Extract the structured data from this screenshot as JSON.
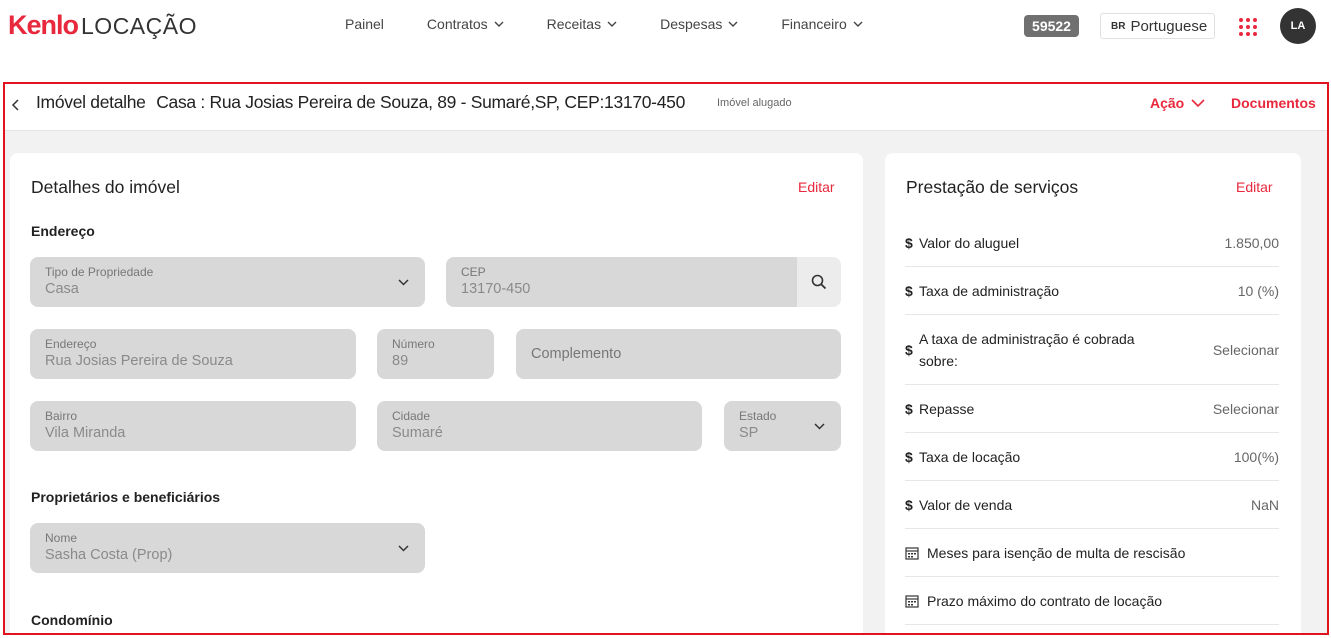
{
  "header": {
    "brand": "Kenlo",
    "product": "LOCAÇÃO",
    "nav": [
      {
        "label": "Painel",
        "has_menu": false
      },
      {
        "label": "Contratos",
        "has_menu": true
      },
      {
        "label": "Receitas",
        "has_menu": true
      },
      {
        "label": "Despesas",
        "has_menu": true
      },
      {
        "label": "Financeiro",
        "has_menu": true
      }
    ],
    "count_badge": "59522",
    "language": {
      "flag": "BR",
      "label": "Portuguese"
    },
    "avatar": "LA",
    "colors": {
      "accent": "#e8283c",
      "badge": "#707070",
      "avatar": "#333333"
    }
  },
  "page": {
    "title": "Imóvel detalhe",
    "subtitle": "Casa : Rua Josias Pereira de Souza, 89 - Sumaré,SP, CEP:13170-450",
    "status": "Imóvel alugado",
    "action_label": "Ação",
    "documents_label": "Documentos"
  },
  "details": {
    "title": "Detalhes do imóvel",
    "edit_label": "Editar",
    "address_section": "Endereço",
    "fields": {
      "tipo": {
        "label": "Tipo de Propriedade",
        "value": "Casa"
      },
      "cep": {
        "label": "CEP",
        "value": "13170-450"
      },
      "endereco": {
        "label": "Endereço",
        "value": "Rua Josias Pereira de Souza"
      },
      "numero": {
        "label": "Número",
        "value": "89"
      },
      "complemento": {
        "placeholder": "Complemento"
      },
      "bairro": {
        "label": "Bairro",
        "value": "Vila Miranda"
      },
      "cidade": {
        "label": "Cidade",
        "value": "Sumaré"
      },
      "estado": {
        "label": "Estado",
        "value": "SP"
      }
    },
    "owners_section": "Proprietários e beneficiários",
    "owner": {
      "label": "Nome",
      "value": "Sasha Costa (Prop)"
    },
    "condo_section": "Condomínio"
  },
  "services": {
    "title": "Prestação de serviços",
    "edit_label": "Editar",
    "rows": [
      {
        "icon": "dollar-icon",
        "label": "Valor do aluguel",
        "value": "1.850,00"
      },
      {
        "icon": "dollar-icon",
        "label": "Taxa de administração",
        "value": "10 (%)"
      },
      {
        "icon": "dollar-icon",
        "label": "A taxa de administração é cobrada sobre:",
        "value": "Selecionar"
      },
      {
        "icon": "dollar-icon",
        "label": "Repasse",
        "value": "Selecionar"
      },
      {
        "icon": "dollar-icon",
        "label": "Taxa de locação",
        "value": "100(%)"
      },
      {
        "icon": "dollar-icon",
        "label": "Valor de venda",
        "value": "NaN"
      },
      {
        "icon": "calendar-icon",
        "label": "Meses para isenção de multa de rescisão",
        "value": ""
      },
      {
        "icon": "calendar-icon",
        "label": "Prazo máximo do contrato de locação",
        "value": ""
      }
    ]
  }
}
